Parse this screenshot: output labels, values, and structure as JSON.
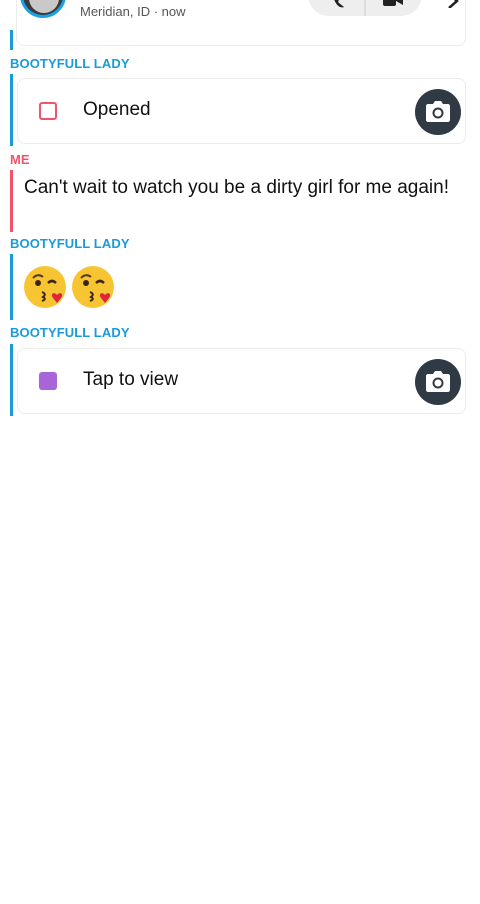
{
  "header": {
    "location": "Meridian, ID · now"
  },
  "colors": {
    "friend": "#1a9bd7",
    "me": "#f0546a",
    "unopened_snap": "#a865d8"
  },
  "messages": [
    {
      "sender": "BOOTYFULL LADY",
      "type": "snap",
      "status": "Opened"
    },
    {
      "sender": "ME",
      "type": "text",
      "text": "Can't wait to watch you be a dirty girl for me again!"
    },
    {
      "sender": "BOOTYFULL LADY",
      "type": "emoji",
      "emoji": [
        "kissing-face-with-heart",
        "kissing-face-with-heart"
      ]
    },
    {
      "sender": "BOOTYFULL LADY",
      "type": "snap",
      "status": "Tap to view"
    }
  ]
}
